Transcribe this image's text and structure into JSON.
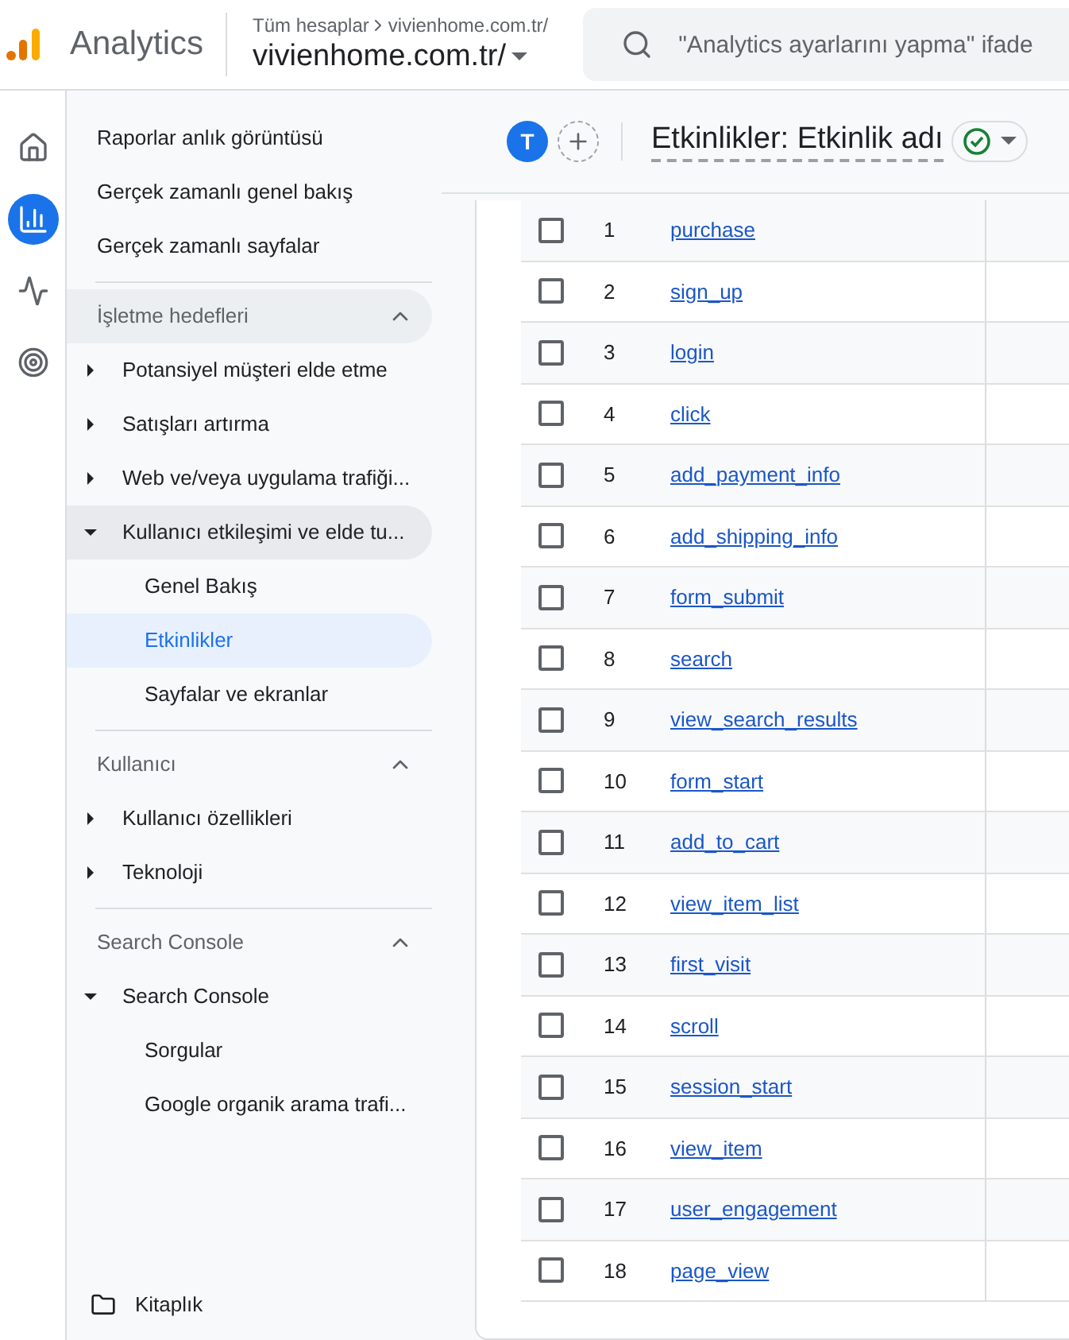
{
  "header": {
    "product": "Analytics",
    "breadcrumb": "Tüm hesaplar",
    "breadcrumb_property": "vivienhome.com.tr/",
    "property": "vivienhome.com.tr/",
    "search": {
      "placeholder": "\"Analytics ayarlarını yapma\" ifade"
    }
  },
  "rail": [
    {
      "kind": "home",
      "selected": false
    },
    {
      "kind": "reports",
      "selected": true
    },
    {
      "kind": "explore",
      "selected": false
    },
    {
      "kind": "advertising",
      "selected": false
    }
  ],
  "sidebar": {
    "top_items": [
      {
        "label": "Raporlar anlık görüntüsü"
      },
      {
        "label": "Gerçek zamanlı genel bakış"
      },
      {
        "label": "Gerçek zamanlı sayfalar"
      }
    ],
    "sections": [
      {
        "title": "İşletme hedefleri",
        "expanded": true,
        "items": [
          {
            "label": "Potansiyel müşteri elde etme",
            "expanded": false
          },
          {
            "label": "Satışları artırma",
            "expanded": false
          },
          {
            "label": "Web ve/veya uygulama trafiği...",
            "expanded": false
          },
          {
            "label": "Kullanıcı etkileşimi ve elde tu...",
            "expanded": true,
            "children": [
              {
                "label": "Genel Bakış",
                "selected": false
              },
              {
                "label": "Etkinlikler",
                "selected": true
              },
              {
                "label": "Sayfalar ve ekranlar",
                "selected": false
              }
            ]
          }
        ]
      },
      {
        "title": "Kullanıcı",
        "expanded": true,
        "items": [
          {
            "label": "Kullanıcı özellikleri",
            "expanded": false
          },
          {
            "label": "Teknoloji",
            "expanded": false
          }
        ]
      },
      {
        "title": "Search Console",
        "expanded": true,
        "items": [
          {
            "label": "Search Console",
            "expanded": true,
            "children": [
              {
                "label": "Sorgular",
                "selected": false
              },
              {
                "label": "Google organik arama trafi...",
                "selected": false
              }
            ]
          }
        ]
      }
    ],
    "library": "Kitaplık"
  },
  "report": {
    "avatar": "T",
    "title": "Etkinlikler: Etkinlik adı",
    "rows": [
      {
        "rank": "1",
        "name": "purchase",
        "checked": false
      },
      {
        "rank": "2",
        "name": "sign_up",
        "checked": false
      },
      {
        "rank": "3",
        "name": "login",
        "checked": false
      },
      {
        "rank": "4",
        "name": "click",
        "checked": false
      },
      {
        "rank": "5",
        "name": "add_payment_info",
        "checked": false
      },
      {
        "rank": "6",
        "name": "add_shipping_info",
        "checked": false
      },
      {
        "rank": "7",
        "name": "form_submit",
        "checked": false
      },
      {
        "rank": "8",
        "name": "search",
        "checked": false
      },
      {
        "rank": "9",
        "name": "view_search_results",
        "checked": false
      },
      {
        "rank": "10",
        "name": "form_start",
        "checked": false
      },
      {
        "rank": "11",
        "name": "add_to_cart",
        "checked": false
      },
      {
        "rank": "12",
        "name": "view_item_list",
        "checked": false
      },
      {
        "rank": "13",
        "name": "first_visit",
        "checked": false
      },
      {
        "rank": "14",
        "name": "scroll",
        "checked": false
      },
      {
        "rank": "15",
        "name": "session_start",
        "checked": false
      },
      {
        "rank": "16",
        "name": "view_item",
        "checked": false
      },
      {
        "rank": "17",
        "name": "user_engagement",
        "checked": false
      },
      {
        "rank": "18",
        "name": "page_view",
        "checked": false
      }
    ]
  }
}
